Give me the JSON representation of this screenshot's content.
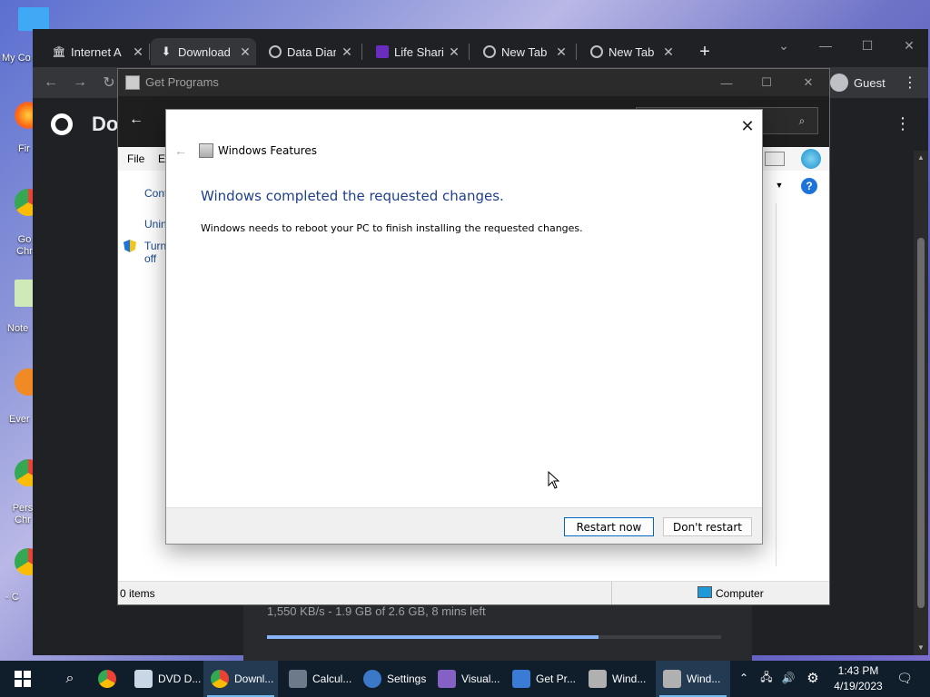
{
  "desktop": {
    "icons": [
      {
        "label": "My Co"
      },
      {
        "label": "Fir"
      },
      {
        "label": "Go Chr"
      },
      {
        "label": "Note"
      },
      {
        "label": "Ever"
      },
      {
        "label": "Pers Chr"
      },
      {
        "label": "- C"
      }
    ]
  },
  "chrome": {
    "tabs": [
      {
        "title": "Internet A"
      },
      {
        "title": "Download"
      },
      {
        "title": "Data Diam"
      },
      {
        "title": "Life Sharin"
      },
      {
        "title": "New Tab"
      },
      {
        "title": "New Tab"
      }
    ],
    "new_tab_glyph": "+",
    "profile": "Guest",
    "page_title": "Do",
    "download": {
      "status": "1,550 KB/s - 1.9 GB of 2.6 GB, 8 mins left",
      "progress_fraction": 0.73
    }
  },
  "get_programs": {
    "title": "Get Programs",
    "menu": [
      "File",
      "Ed"
    ],
    "left_links": [
      "Cont",
      "Unin",
      "Turn",
      "off"
    ],
    "status_items": "0 items",
    "status_location": "Computer",
    "help_glyph": "?"
  },
  "dialog": {
    "app_title": "Windows Features",
    "heading": "Windows completed the requested changes.",
    "message": "Windows needs to reboot your PC to finish installing the requested changes.",
    "restart_button": "Restart now",
    "dont_restart_button": "Don't restart"
  },
  "taskbar": {
    "items": [
      {
        "label": ""
      },
      {
        "label": "DVD D..."
      },
      {
        "label": "Downl..."
      },
      {
        "label": "Calcul..."
      },
      {
        "label": "Settings"
      },
      {
        "label": "Visual..."
      },
      {
        "label": "Get Pr..."
      },
      {
        "label": "Wind..."
      },
      {
        "label": "Wind..."
      }
    ],
    "time": "1:43 PM",
    "date": "4/19/2023"
  },
  "colors": {
    "accent": "#0067c0",
    "dialog_heading": "#1f3f8f",
    "taskbar": "#101d2b",
    "chrome_bg": "#202124"
  }
}
